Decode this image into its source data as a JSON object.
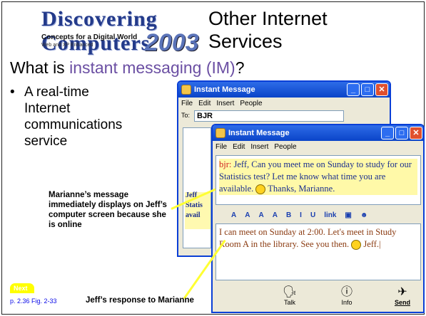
{
  "logo": {
    "line1": "Discovering Computers",
    "year": "2003",
    "line2": "Concepts for a Digital World",
    "line3": "Web and XP Enhanced"
  },
  "slide": {
    "title": "Other Internet Services",
    "question_prefix": "What is ",
    "question_term": "instant messaging (IM)",
    "question_suffix": "?",
    "bullet": "A real-time Internet communications service"
  },
  "captions": {
    "marianne": "Marianne’s message immediately displays on Jeff’s computer screen because she is online",
    "jeff": "Jeff’s response to Marianne"
  },
  "nav": {
    "next": "Next",
    "page_ref": "p. 2.36 Fig. 2-33"
  },
  "window1": {
    "title": "Instant Message",
    "menu": [
      "File",
      "Edit",
      "Insert",
      "People"
    ],
    "to_label": "To:",
    "to_value": "BJR",
    "peek": "Jeff,\nStatis\navail"
  },
  "window2": {
    "title": "Instant Message",
    "menu": [
      "File",
      "Edit",
      "Insert",
      "People"
    ],
    "history_nick": "bjr:",
    "history_text": " Jeff, Can you meet me on Sunday to study for our Statistics test? Let me know what time you are available. ",
    "history_end": " Thanks, Marianne.",
    "format_bar": [
      "A",
      "A",
      "A",
      "A",
      "B",
      "I",
      "U",
      "link"
    ],
    "compose_text": "I can meet on Sunday at 2:00. Let's meet in Study Room A in the library. See you then.",
    "compose_end": " Jeff.",
    "buttons": {
      "talk": "Talk",
      "info": "Info",
      "send": "Send"
    }
  },
  "colors": {
    "accent_purple": "#6b4fa3",
    "title_bar": "#0a44c8",
    "highlight": "#ffff33",
    "message_blue": "#1a2e8f"
  }
}
